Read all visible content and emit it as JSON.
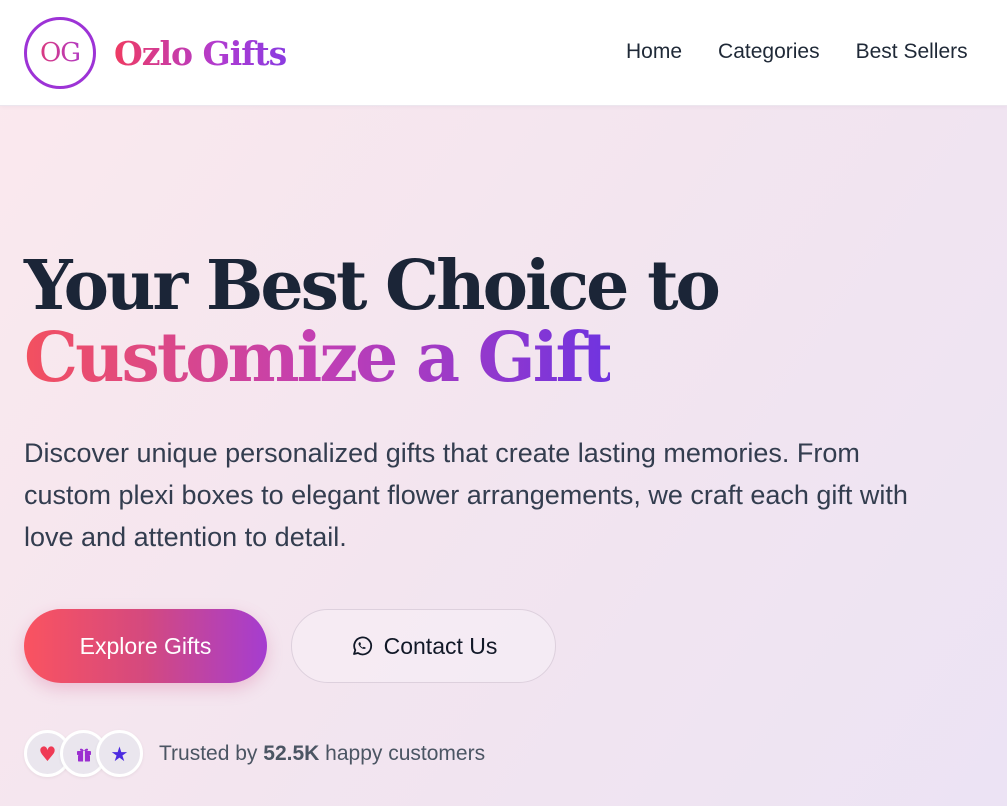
{
  "brand": {
    "monogram": "OG",
    "name": "Ozlo Gifts"
  },
  "nav": {
    "items": [
      "Home",
      "Categories",
      "Best Sellers"
    ]
  },
  "hero": {
    "headline_line1": "Your Best Choice to",
    "headline_line2": "Customize a Gift",
    "subtitle": "Discover unique personalized gifts that create lasting memories. From custom plexi boxes to elegant flower arrangements, we craft each gift with love and attention to detail.",
    "primary_cta": "Explore Gifts",
    "secondary_cta": "Contact Us",
    "secondary_cta_icon": "whatsapp-icon"
  },
  "trust": {
    "prefix": "Trusted by",
    "count": "52.5K",
    "suffix": "happy customers",
    "badges": [
      "heart-icon",
      "gift-icon",
      "star-icon"
    ]
  },
  "colors": {
    "brand_pink": "#ef3b62",
    "brand_purple": "#a73ad6",
    "accent_violet": "#6f33e0",
    "heading_dark": "#1b2537"
  }
}
